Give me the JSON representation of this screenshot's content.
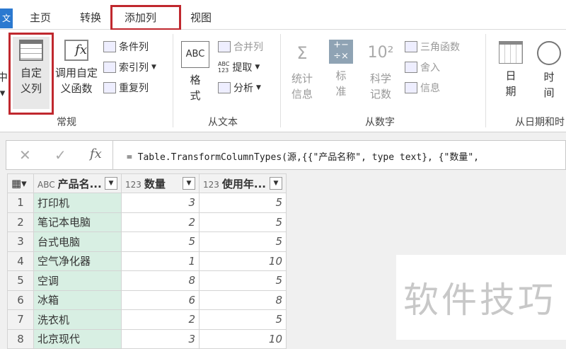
{
  "tabs": {
    "file": "文",
    "items": [
      "主页",
      "转换",
      "添加列",
      "视图"
    ],
    "active": "添加列"
  },
  "ribbon": {
    "left_cut": {
      "line1": "中",
      "arrow": "▾"
    },
    "general": {
      "label": "常规",
      "custom_column": "自定\n义列",
      "custom_line1": "自定",
      "custom_line2": "义列",
      "invoke_line1": "调用自定",
      "invoke_line2": "义函数",
      "conditional": "条件列",
      "index": "索引列",
      "duplicate": "重复列"
    },
    "text": {
      "label": "从文本",
      "format_line1": "格",
      "format_line2": "式",
      "merge": "合并列",
      "extract": "提取",
      "parse": "分析",
      "abc": "ABC",
      "n123": "123"
    },
    "number": {
      "label": "从数字",
      "stats_line1": "统计",
      "stats_line2": "信息",
      "std_line1": "标",
      "std_line2": "准",
      "sci_line1": "科学",
      "sci_line2": "记数",
      "trig": "三角函数",
      "round": "舍入",
      "info": "信息",
      "sci_icon": "10²"
    },
    "datetime": {
      "label": "从日期和时",
      "date_line1": "日",
      "date_line2": "期",
      "time_line1": "时",
      "time_line2": "间"
    }
  },
  "formula": {
    "cancel": "✕",
    "confirm": "✓",
    "fx": "fx",
    "text": "= Table.TransformColumnTypes(源,{{\"产品名称\", type text}, {\"数量\","
  },
  "table": {
    "columns": [
      {
        "type": "ABC",
        "name": "产品名..."
      },
      {
        "type": "123",
        "name": "数量"
      },
      {
        "type": "123",
        "name": "使用年..."
      }
    ],
    "rows": [
      [
        "1",
        "打印机",
        "3",
        "5"
      ],
      [
        "2",
        "笔记本电脑",
        "2",
        "5"
      ],
      [
        "3",
        "台式电脑",
        "5",
        "5"
      ],
      [
        "4",
        "空气净化器",
        "1",
        "10"
      ],
      [
        "5",
        "空调",
        "8",
        "5"
      ],
      [
        "6",
        "冰箱",
        "6",
        "8"
      ],
      [
        "7",
        "洗衣机",
        "2",
        "5"
      ],
      [
        "8",
        "北京现代",
        "3",
        "10"
      ]
    ]
  },
  "watermark": "软件技巧"
}
